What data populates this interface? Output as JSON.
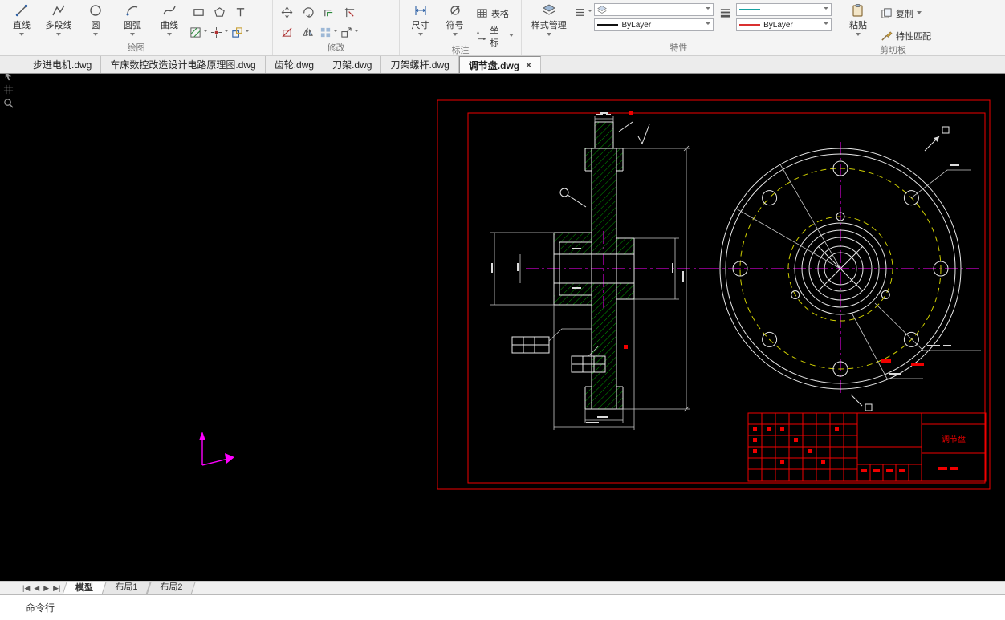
{
  "ribbon": {
    "draw": {
      "label": "绘图",
      "line": "直线",
      "polyline": "多段线",
      "circle": "圆",
      "arc": "圆弧",
      "curve": "曲线"
    },
    "modify": {
      "label": "修改"
    },
    "annotate": {
      "label": "标注",
      "dimension": "尺寸",
      "symbol": "符号",
      "table": "表格",
      "coordinate": "坐标"
    },
    "properties": {
      "label": "特性",
      "style_manager": "样式管理",
      "layer_value": "ByLayer",
      "linetype_value": "ByLayer"
    },
    "clipboard": {
      "label": "剪切板",
      "paste": "粘贴",
      "copy": "复制",
      "match": "特性匹配"
    }
  },
  "doc_tabs": [
    {
      "label": "步进电机.dwg"
    },
    {
      "label": "车床数控改造设计电路原理图.dwg"
    },
    {
      "label": "齿轮.dwg"
    },
    {
      "label": "刀架.dwg"
    },
    {
      "label": "刀架螺杆.dwg"
    },
    {
      "label": "调节盘.dwg"
    }
  ],
  "ui": {
    "close_glyph": "×"
  },
  "drawing": {
    "title_block_part_name": "调节盘"
  },
  "layout_bar": {
    "nav": {
      "first": "|◀",
      "prev": "◀",
      "next": "▶",
      "last": "▶|"
    },
    "model": "模型",
    "layout1": "布局1",
    "layout2": "布局2"
  },
  "command_line": {
    "label": "命令行"
  },
  "colors": {
    "sheet_frame": "#f00000",
    "centerline": "#ff00ff",
    "pitch_circle": "#cfcf00",
    "hatch": "#00aa00",
    "object_line": "#e8e8e8"
  }
}
